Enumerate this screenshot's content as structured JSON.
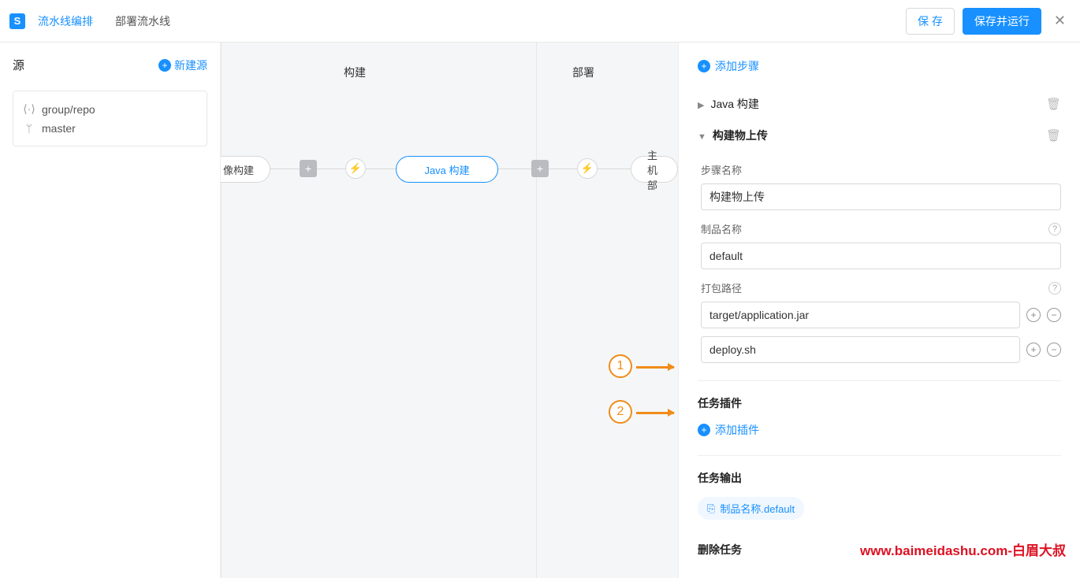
{
  "topbar": {
    "logo_letter": "S",
    "tab_active": "流水线编排",
    "tab_other": "部署流水线",
    "save": "保 存",
    "save_run": "保存并运行"
  },
  "source": {
    "title": "源",
    "add": "新建源",
    "repo": "group/repo",
    "branch": "master"
  },
  "stages": {
    "build": "构建",
    "deploy": "部署"
  },
  "nodes": {
    "image_build": "像构建",
    "java_build": "Java 构建",
    "host_deploy": "主机部"
  },
  "panel": {
    "add_step": "添加步骤",
    "step_java_build": "Java 构建",
    "step_upload": "构建物上传",
    "label_step_name": "步骤名称",
    "value_step_name": "构建物上传",
    "label_artifact_name": "制品名称",
    "value_artifact_name": "default",
    "label_pack_path": "打包路径",
    "path1": "target/application.jar",
    "path2": "deploy.sh",
    "section_plugins": "任务插件",
    "add_plugin": "添加插件",
    "section_output": "任务输出",
    "output_tag": "制品名称.default",
    "section_delete": "删除任务"
  },
  "annotations": {
    "n1": "1",
    "n2": "2"
  },
  "watermark": "www.baimeidashu.com-白眉大叔"
}
